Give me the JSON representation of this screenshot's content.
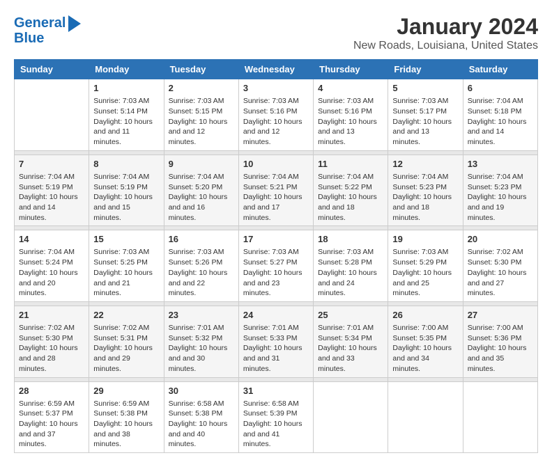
{
  "logo": {
    "line1": "General",
    "line2": "Blue"
  },
  "title": "January 2024",
  "subtitle": "New Roads, Louisiana, United States",
  "days_of_week": [
    "Sunday",
    "Monday",
    "Tuesday",
    "Wednesday",
    "Thursday",
    "Friday",
    "Saturday"
  ],
  "weeks": [
    [
      {
        "day": "",
        "sunrise": "",
        "sunset": "",
        "daylight": ""
      },
      {
        "day": "1",
        "sunrise": "Sunrise: 7:03 AM",
        "sunset": "Sunset: 5:14 PM",
        "daylight": "Daylight: 10 hours and 11 minutes."
      },
      {
        "day": "2",
        "sunrise": "Sunrise: 7:03 AM",
        "sunset": "Sunset: 5:15 PM",
        "daylight": "Daylight: 10 hours and 12 minutes."
      },
      {
        "day": "3",
        "sunrise": "Sunrise: 7:03 AM",
        "sunset": "Sunset: 5:16 PM",
        "daylight": "Daylight: 10 hours and 12 minutes."
      },
      {
        "day": "4",
        "sunrise": "Sunrise: 7:03 AM",
        "sunset": "Sunset: 5:16 PM",
        "daylight": "Daylight: 10 hours and 13 minutes."
      },
      {
        "day": "5",
        "sunrise": "Sunrise: 7:03 AM",
        "sunset": "Sunset: 5:17 PM",
        "daylight": "Daylight: 10 hours and 13 minutes."
      },
      {
        "day": "6",
        "sunrise": "Sunrise: 7:04 AM",
        "sunset": "Sunset: 5:18 PM",
        "daylight": "Daylight: 10 hours and 14 minutes."
      }
    ],
    [
      {
        "day": "7",
        "sunrise": "Sunrise: 7:04 AM",
        "sunset": "Sunset: 5:19 PM",
        "daylight": "Daylight: 10 hours and 14 minutes."
      },
      {
        "day": "8",
        "sunrise": "Sunrise: 7:04 AM",
        "sunset": "Sunset: 5:19 PM",
        "daylight": "Daylight: 10 hours and 15 minutes."
      },
      {
        "day": "9",
        "sunrise": "Sunrise: 7:04 AM",
        "sunset": "Sunset: 5:20 PM",
        "daylight": "Daylight: 10 hours and 16 minutes."
      },
      {
        "day": "10",
        "sunrise": "Sunrise: 7:04 AM",
        "sunset": "Sunset: 5:21 PM",
        "daylight": "Daylight: 10 hours and 17 minutes."
      },
      {
        "day": "11",
        "sunrise": "Sunrise: 7:04 AM",
        "sunset": "Sunset: 5:22 PM",
        "daylight": "Daylight: 10 hours and 18 minutes."
      },
      {
        "day": "12",
        "sunrise": "Sunrise: 7:04 AM",
        "sunset": "Sunset: 5:23 PM",
        "daylight": "Daylight: 10 hours and 18 minutes."
      },
      {
        "day": "13",
        "sunrise": "Sunrise: 7:04 AM",
        "sunset": "Sunset: 5:23 PM",
        "daylight": "Daylight: 10 hours and 19 minutes."
      }
    ],
    [
      {
        "day": "14",
        "sunrise": "Sunrise: 7:04 AM",
        "sunset": "Sunset: 5:24 PM",
        "daylight": "Daylight: 10 hours and 20 minutes."
      },
      {
        "day": "15",
        "sunrise": "Sunrise: 7:03 AM",
        "sunset": "Sunset: 5:25 PM",
        "daylight": "Daylight: 10 hours and 21 minutes."
      },
      {
        "day": "16",
        "sunrise": "Sunrise: 7:03 AM",
        "sunset": "Sunset: 5:26 PM",
        "daylight": "Daylight: 10 hours and 22 minutes."
      },
      {
        "day": "17",
        "sunrise": "Sunrise: 7:03 AM",
        "sunset": "Sunset: 5:27 PM",
        "daylight": "Daylight: 10 hours and 23 minutes."
      },
      {
        "day": "18",
        "sunrise": "Sunrise: 7:03 AM",
        "sunset": "Sunset: 5:28 PM",
        "daylight": "Daylight: 10 hours and 24 minutes."
      },
      {
        "day": "19",
        "sunrise": "Sunrise: 7:03 AM",
        "sunset": "Sunset: 5:29 PM",
        "daylight": "Daylight: 10 hours and 25 minutes."
      },
      {
        "day": "20",
        "sunrise": "Sunrise: 7:02 AM",
        "sunset": "Sunset: 5:30 PM",
        "daylight": "Daylight: 10 hours and 27 minutes."
      }
    ],
    [
      {
        "day": "21",
        "sunrise": "Sunrise: 7:02 AM",
        "sunset": "Sunset: 5:30 PM",
        "daylight": "Daylight: 10 hours and 28 minutes."
      },
      {
        "day": "22",
        "sunrise": "Sunrise: 7:02 AM",
        "sunset": "Sunset: 5:31 PM",
        "daylight": "Daylight: 10 hours and 29 minutes."
      },
      {
        "day": "23",
        "sunrise": "Sunrise: 7:01 AM",
        "sunset": "Sunset: 5:32 PM",
        "daylight": "Daylight: 10 hours and 30 minutes."
      },
      {
        "day": "24",
        "sunrise": "Sunrise: 7:01 AM",
        "sunset": "Sunset: 5:33 PM",
        "daylight": "Daylight: 10 hours and 31 minutes."
      },
      {
        "day": "25",
        "sunrise": "Sunrise: 7:01 AM",
        "sunset": "Sunset: 5:34 PM",
        "daylight": "Daylight: 10 hours and 33 minutes."
      },
      {
        "day": "26",
        "sunrise": "Sunrise: 7:00 AM",
        "sunset": "Sunset: 5:35 PM",
        "daylight": "Daylight: 10 hours and 34 minutes."
      },
      {
        "day": "27",
        "sunrise": "Sunrise: 7:00 AM",
        "sunset": "Sunset: 5:36 PM",
        "daylight": "Daylight: 10 hours and 35 minutes."
      }
    ],
    [
      {
        "day": "28",
        "sunrise": "Sunrise: 6:59 AM",
        "sunset": "Sunset: 5:37 PM",
        "daylight": "Daylight: 10 hours and 37 minutes."
      },
      {
        "day": "29",
        "sunrise": "Sunrise: 6:59 AM",
        "sunset": "Sunset: 5:38 PM",
        "daylight": "Daylight: 10 hours and 38 minutes."
      },
      {
        "day": "30",
        "sunrise": "Sunrise: 6:58 AM",
        "sunset": "Sunset: 5:38 PM",
        "daylight": "Daylight: 10 hours and 40 minutes."
      },
      {
        "day": "31",
        "sunrise": "Sunrise: 6:58 AM",
        "sunset": "Sunset: 5:39 PM",
        "daylight": "Daylight: 10 hours and 41 minutes."
      },
      {
        "day": "",
        "sunrise": "",
        "sunset": "",
        "daylight": ""
      },
      {
        "day": "",
        "sunrise": "",
        "sunset": "",
        "daylight": ""
      },
      {
        "day": "",
        "sunrise": "",
        "sunset": "",
        "daylight": ""
      }
    ]
  ]
}
